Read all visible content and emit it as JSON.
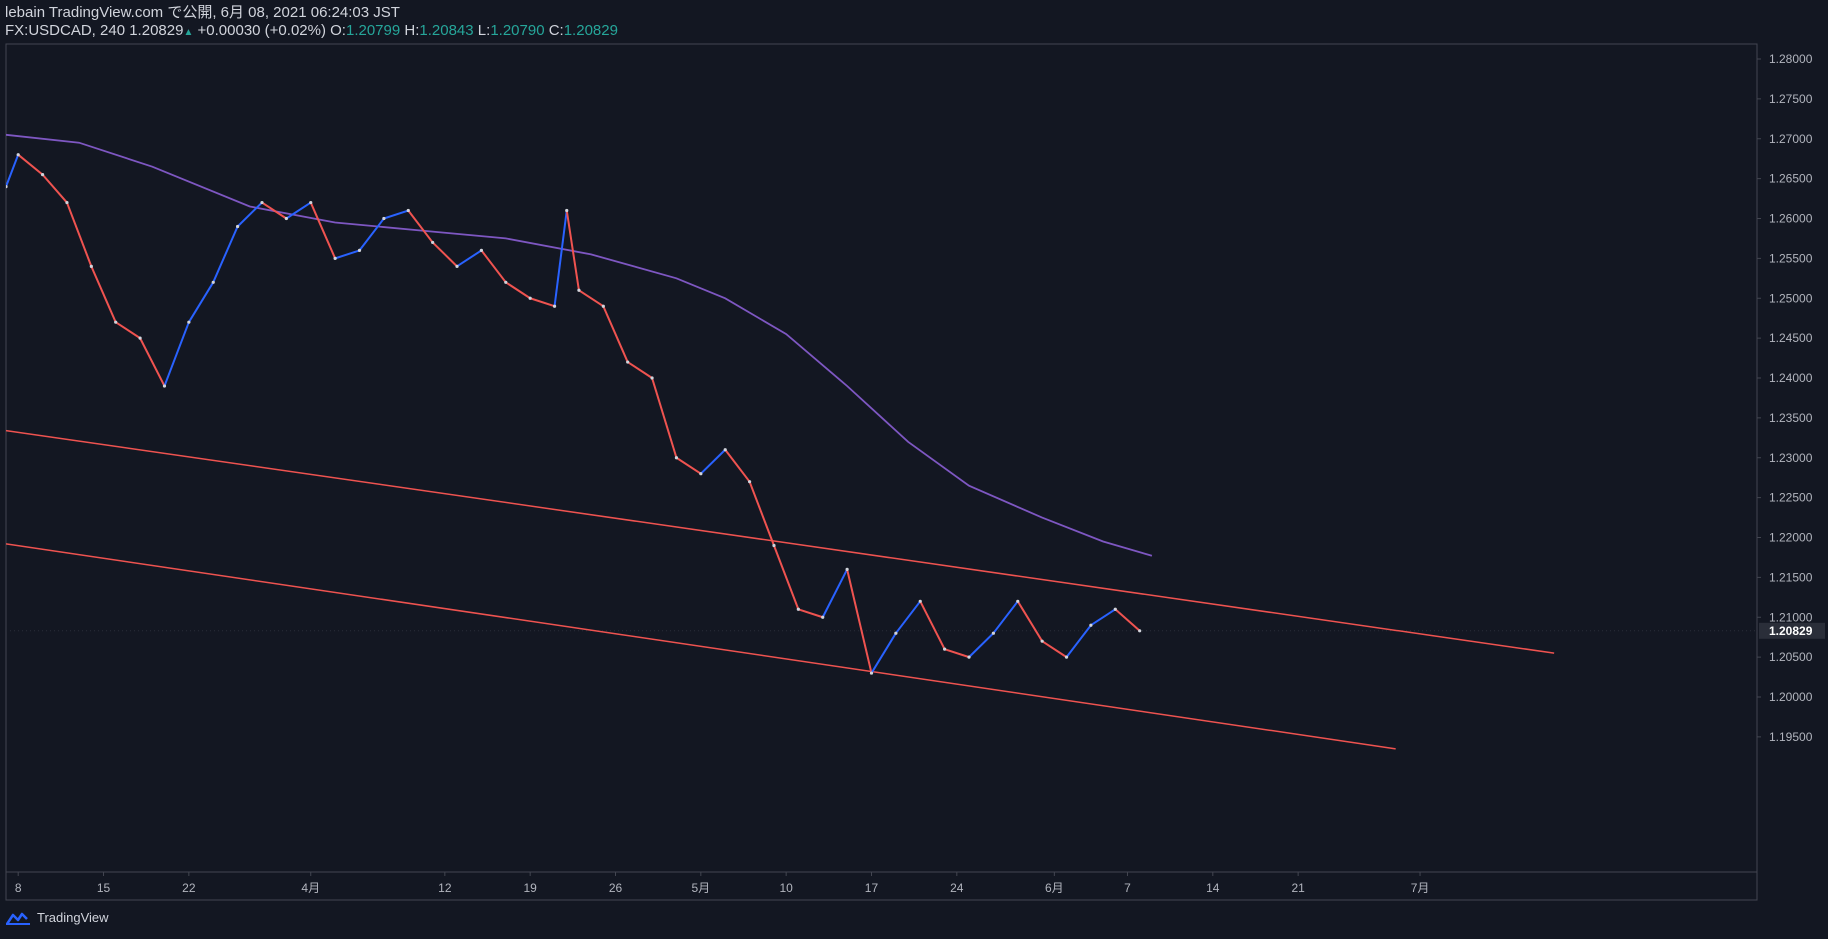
{
  "header": {
    "line1": "lebain TradingView.com で公開, 6月 08, 2021 06:24:03 JST",
    "symbol": "FX:USDCAD, 240",
    "last": "1.20829",
    "up_arrow": "▲",
    "change": "+0.00030 (+0.02%)",
    "o_label": "O:",
    "o_value": "1.20799",
    "h_label": "H:",
    "h_value": "1.20843",
    "l_label": "L:",
    "l_value": "1.20790",
    "c_label": "C:",
    "c_value": "1.20829"
  },
  "footer": {
    "brand": "TradingView",
    "logo_icon": "tradingview-logo-icon"
  },
  "colors": {
    "background": "#131722",
    "up": "#2962ff",
    "down": "#ef5350",
    "ma": "#7e57c2",
    "trendline": "#ef5350",
    "axis_text": "#b2b5be",
    "border": "#434651"
  },
  "chart_data": {
    "type": "line",
    "ylim": [
      1.1935,
      1.2825
    ],
    "y_ticks": [
      "1.28000",
      "1.27500",
      "1.27000",
      "1.26500",
      "1.26000",
      "1.25500",
      "1.25000",
      "1.24500",
      "1.24000",
      "1.23500",
      "1.23000",
      "1.22500",
      "1.22000",
      "1.21500",
      "1.21000",
      "1.20500",
      "1.20000",
      "1.19500"
    ],
    "x_tick_labels": [
      "8",
      "15",
      "22",
      "4月",
      "12",
      "19",
      "26",
      "5月",
      "10",
      "17",
      "24",
      "6月",
      "7",
      "14",
      "21",
      "7月"
    ],
    "last_price_label": "1.20829",
    "series": [
      {
        "kind": "price",
        "x": [
          "2021-03-07",
          "2021-03-08",
          "2021-03-10",
          "2021-03-12",
          "2021-03-14",
          "2021-03-16",
          "2021-03-18",
          "2021-03-20",
          "2021-03-22",
          "2021-03-24",
          "2021-03-26",
          "2021-03-28",
          "2021-03-30",
          "2021-04-01",
          "2021-04-03",
          "2021-04-05",
          "2021-04-07",
          "2021-04-09",
          "2021-04-11",
          "2021-04-13",
          "2021-04-15",
          "2021-04-17",
          "2021-04-19",
          "2021-04-21",
          "2021-04-22",
          "2021-04-23",
          "2021-04-25",
          "2021-04-27",
          "2021-04-29",
          "2021-05-01",
          "2021-05-03",
          "2021-05-05",
          "2021-05-07",
          "2021-05-09",
          "2021-05-11",
          "2021-05-13",
          "2021-05-15",
          "2021-05-17",
          "2021-05-19",
          "2021-05-21",
          "2021-05-23",
          "2021-05-25",
          "2021-05-27",
          "2021-05-29",
          "2021-05-31",
          "2021-06-02",
          "2021-06-04",
          "2021-06-06",
          "2021-06-08"
        ],
        "values": [
          1.264,
          1.268,
          1.2655,
          1.262,
          1.254,
          1.247,
          1.245,
          1.239,
          1.247,
          1.252,
          1.259,
          1.262,
          1.26,
          1.262,
          1.255,
          1.256,
          1.26,
          1.261,
          1.257,
          1.254,
          1.256,
          1.252,
          1.25,
          1.249,
          1.261,
          1.251,
          1.249,
          1.242,
          1.24,
          1.23,
          1.228,
          1.231,
          1.227,
          1.219,
          1.211,
          1.21,
          1.216,
          1.203,
          1.208,
          1.212,
          1.206,
          1.205,
          1.208,
          1.212,
          1.207,
          1.205,
          1.209,
          1.211,
          1.2083
        ]
      },
      {
        "kind": "moving-average",
        "x": [
          "2021-03-07",
          "2021-03-13",
          "2021-03-19",
          "2021-03-27",
          "2021-04-03",
          "2021-04-10",
          "2021-04-17",
          "2021-04-24",
          "2021-05-01",
          "2021-05-05",
          "2021-05-10",
          "2021-05-15",
          "2021-05-20",
          "2021-05-25",
          "2021-05-31",
          "2021-06-05",
          "2021-06-09"
        ],
        "values": [
          1.2705,
          1.2695,
          1.2665,
          1.2615,
          1.2595,
          1.2585,
          1.2575,
          1.2555,
          1.2525,
          1.25,
          1.2455,
          1.239,
          1.232,
          1.2265,
          1.2225,
          1.2195,
          1.2177
        ]
      },
      {
        "kind": "trendline-upper",
        "x": [
          "2021-03-07",
          "2021-07-12"
        ],
        "values": [
          1.2334,
          1.2055
        ]
      },
      {
        "kind": "trendline-lower",
        "x": [
          "2021-03-07",
          "2021-06-29"
        ],
        "values": [
          1.2192,
          1.1935
        ]
      }
    ]
  }
}
